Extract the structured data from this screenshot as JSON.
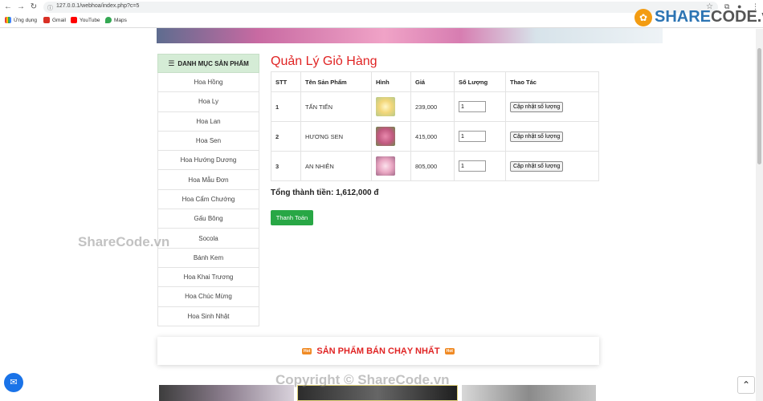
{
  "browser": {
    "url": "127.0.0.1/webhoa/index.php?c=5",
    "bookmarks": [
      {
        "label": "Ứng dụng",
        "color": "#e94235"
      },
      {
        "label": "Gmail",
        "color": "#d93025"
      },
      {
        "label": "YouTube",
        "color": "#ff0000"
      },
      {
        "label": "Maps",
        "color": "#34a853"
      }
    ]
  },
  "logo": {
    "prefix": "SHARE",
    "suffix": "CODE.vn"
  },
  "sidebar": {
    "heading": "DANH MỤC SẢN PHẨM",
    "items": [
      "Hoa Hồng",
      "Hoa Ly",
      "Hoa Lan",
      "Hoa Sen",
      "Hoa Hướng Dương",
      "Hoa Mẫu Đơn",
      "Hoa Cẩm Chướng",
      "Gấu Bông",
      "Socola",
      "Bánh Kem",
      "Hoa Khai Trương",
      "Hoa Chúc Mừng",
      "Hoa Sinh Nhật"
    ]
  },
  "cart": {
    "title": "Quản Lý Giỏ Hàng",
    "columns": [
      "STT",
      "Tên Sản Phẩm",
      "Hình",
      "Giá",
      "Số Lượng",
      "Thao Tác"
    ],
    "rows": [
      {
        "stt": "1",
        "name": "TẤN TIẾN",
        "price": "239,000",
        "qty": "1",
        "action": "Cập nhật số lượng",
        "thumb_color": "#f3d77a"
      },
      {
        "stt": "2",
        "name": "HƯƠNG SEN",
        "price": "415,000",
        "qty": "1",
        "action": "Cập nhật số lượng",
        "thumb_color": "#c0587f"
      },
      {
        "stt": "3",
        "name": "AN NHIÊN",
        "price": "805,000",
        "qty": "1",
        "action": "Cập nhật số lượng",
        "thumb_color": "#e9a6c2"
      }
    ],
    "total_label": "Tổng thành tiền: 1,612,000 đ",
    "pay_label": "Thanh Toán"
  },
  "bestseller": {
    "title": "SẢN PHẨM BÁN CHẠY NHẤT",
    "badge": "Hot"
  },
  "watermarks": [
    "ShareCode.vn",
    "Copyright © ShareCode.vn"
  ]
}
